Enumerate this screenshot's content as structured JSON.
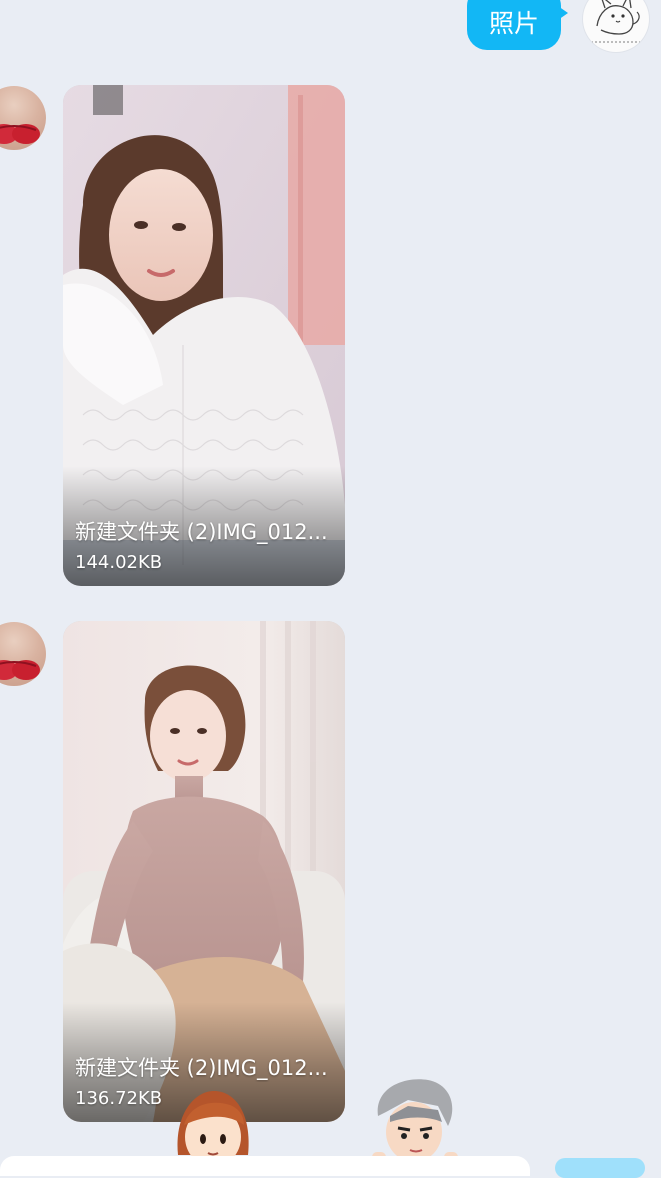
{
  "messages": {
    "outgoing": {
      "text": "照片"
    },
    "incoming": [
      {
        "file_name": "新建文件夹 (2)IMG_012...",
        "file_size": "144.02KB"
      },
      {
        "file_name": "新建文件夹 (2)IMG_012...",
        "file_size": "136.72KB"
      }
    ]
  },
  "colors": {
    "background": "#e9edf4",
    "outgoing_bubble": "#12b7f5"
  },
  "icons": {
    "self_avatar": "cat-sketch-avatar",
    "peer_avatar": "photo-avatar"
  }
}
